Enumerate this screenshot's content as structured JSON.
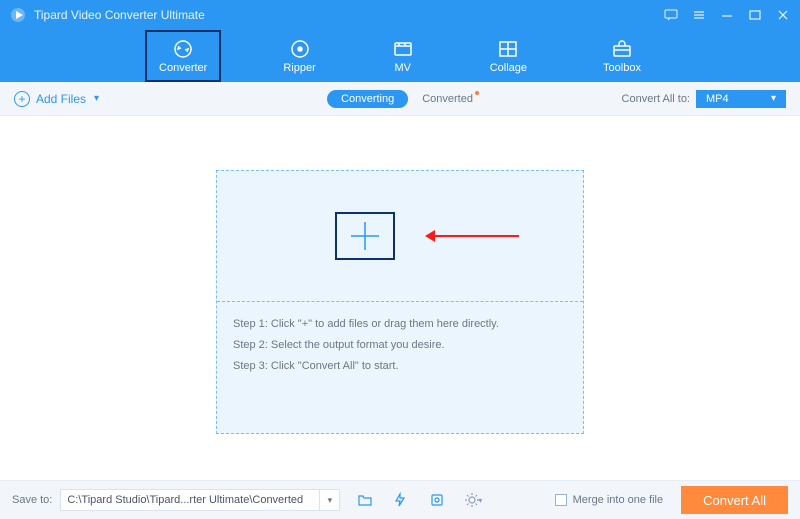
{
  "titlebar": {
    "title": "Tipard Video Converter Ultimate"
  },
  "topnav": {
    "tabs": [
      {
        "label": "Converter",
        "active": true
      },
      {
        "label": "Ripper"
      },
      {
        "label": "MV"
      },
      {
        "label": "Collage"
      },
      {
        "label": "Toolbox"
      }
    ]
  },
  "toolbar": {
    "add_files": "Add Files",
    "converting": "Converting",
    "converted": "Converted",
    "convert_all_to": "Convert All to:",
    "format": "MP4"
  },
  "dropzone": {
    "step1": "Step 1: Click \"+\" to add files or drag them here directly.",
    "step2": "Step 2: Select the output format you desire.",
    "step3": "Step 3: Click \"Convert All\" to start."
  },
  "footer": {
    "save_to": "Save to:",
    "path": "C:\\Tipard Studio\\Tipard...rter Ultimate\\Converted",
    "merge": "Merge into one file",
    "convert_all": "Convert All"
  }
}
